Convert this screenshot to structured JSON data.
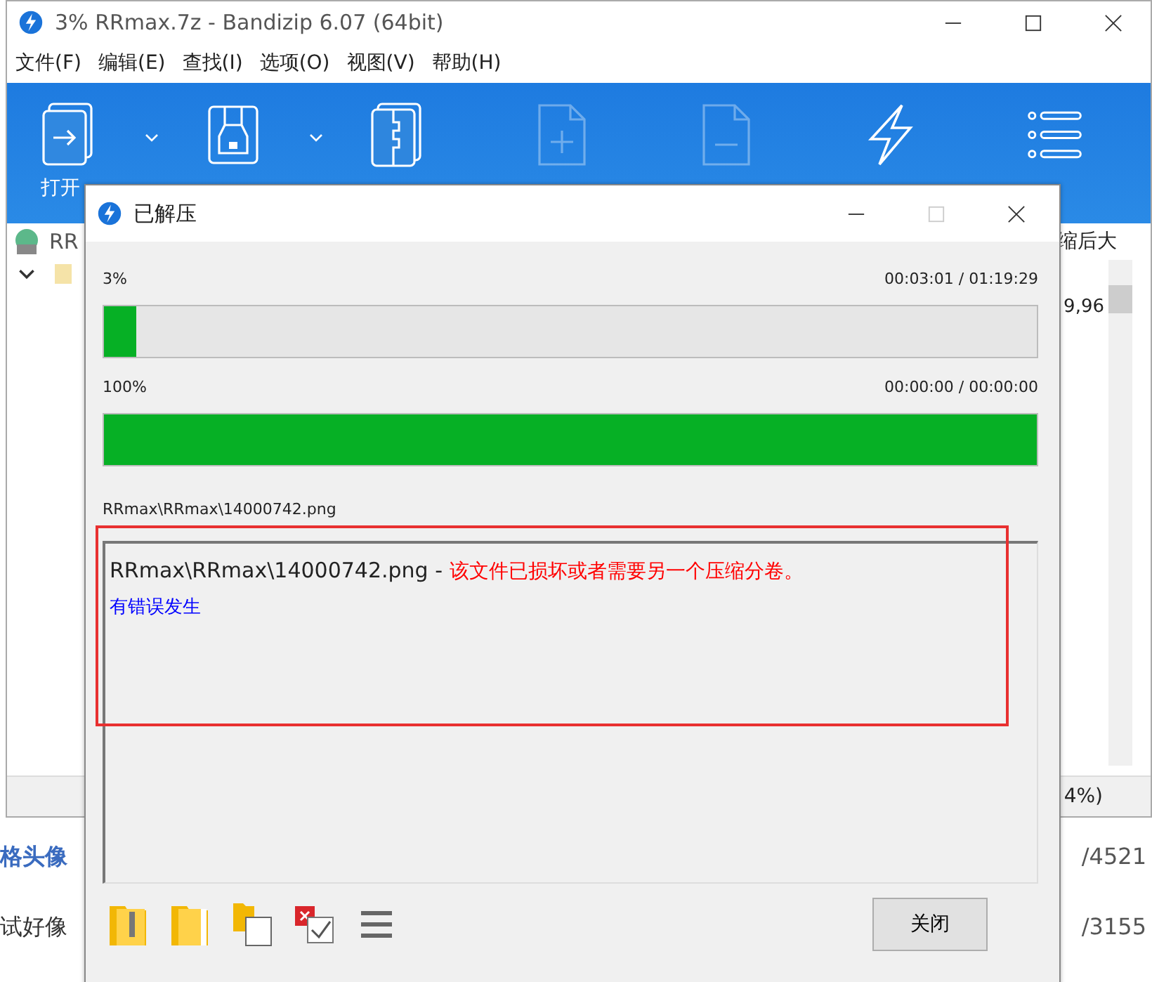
{
  "background_page": {
    "rows": [
      {
        "title": "格头像",
        "count": "/4521"
      },
      {
        "title": "试好像",
        "count": "/3155"
      }
    ]
  },
  "main_window": {
    "title": "3% RRmax.7z - Bandizip 6.07 (64bit)",
    "menu": [
      "文件(F)",
      "编辑(E)",
      "查找(I)",
      "选项(O)",
      "视图(V)",
      "帮助(H)"
    ],
    "toolbar": [
      {
        "kind": "open",
        "label": "打开",
        "disabled": false,
        "dropdown": true
      },
      {
        "kind": "extract",
        "disabled": false,
        "dropdown": true
      },
      {
        "kind": "archive",
        "disabled": false,
        "dropdown": false
      },
      {
        "kind": "add",
        "disabled": true,
        "dropdown": false
      },
      {
        "kind": "remove",
        "disabled": true,
        "dropdown": false
      },
      {
        "kind": "flash",
        "disabled": false,
        "dropdown": false
      },
      {
        "kind": "list",
        "disabled": false,
        "dropdown": false
      }
    ],
    "list": {
      "archive_name": "RR",
      "column_header": "缩后大",
      "size": "9,96"
    },
    "status": "4%)"
  },
  "dialog": {
    "title": "已解压",
    "progress": [
      {
        "percent": "3%",
        "time": "00:03:01 / 01:19:29",
        "level": 0.035
      },
      {
        "percent": "100%",
        "time": "00:00:00 / 00:00:00",
        "level": 1
      }
    ],
    "current_file": "RRmax\\RRmax\\14000742.png",
    "log": [
      {
        "kind": "error",
        "path": "RRmax\\RRmax\\14000742.png - ",
        "message": "该文件已损坏或者需要另一个压缩分卷。"
      },
      {
        "kind": "summary",
        "text": "有错误发生"
      }
    ],
    "bottom_icons": [
      {
        "kind": "zip-folder"
      },
      {
        "kind": "folder"
      },
      {
        "kind": "copy"
      },
      {
        "kind": "checklist"
      },
      {
        "kind": "menu"
      }
    ],
    "close_button": "关闭"
  },
  "annotations": [
    {
      "kind": "frame"
    }
  ]
}
